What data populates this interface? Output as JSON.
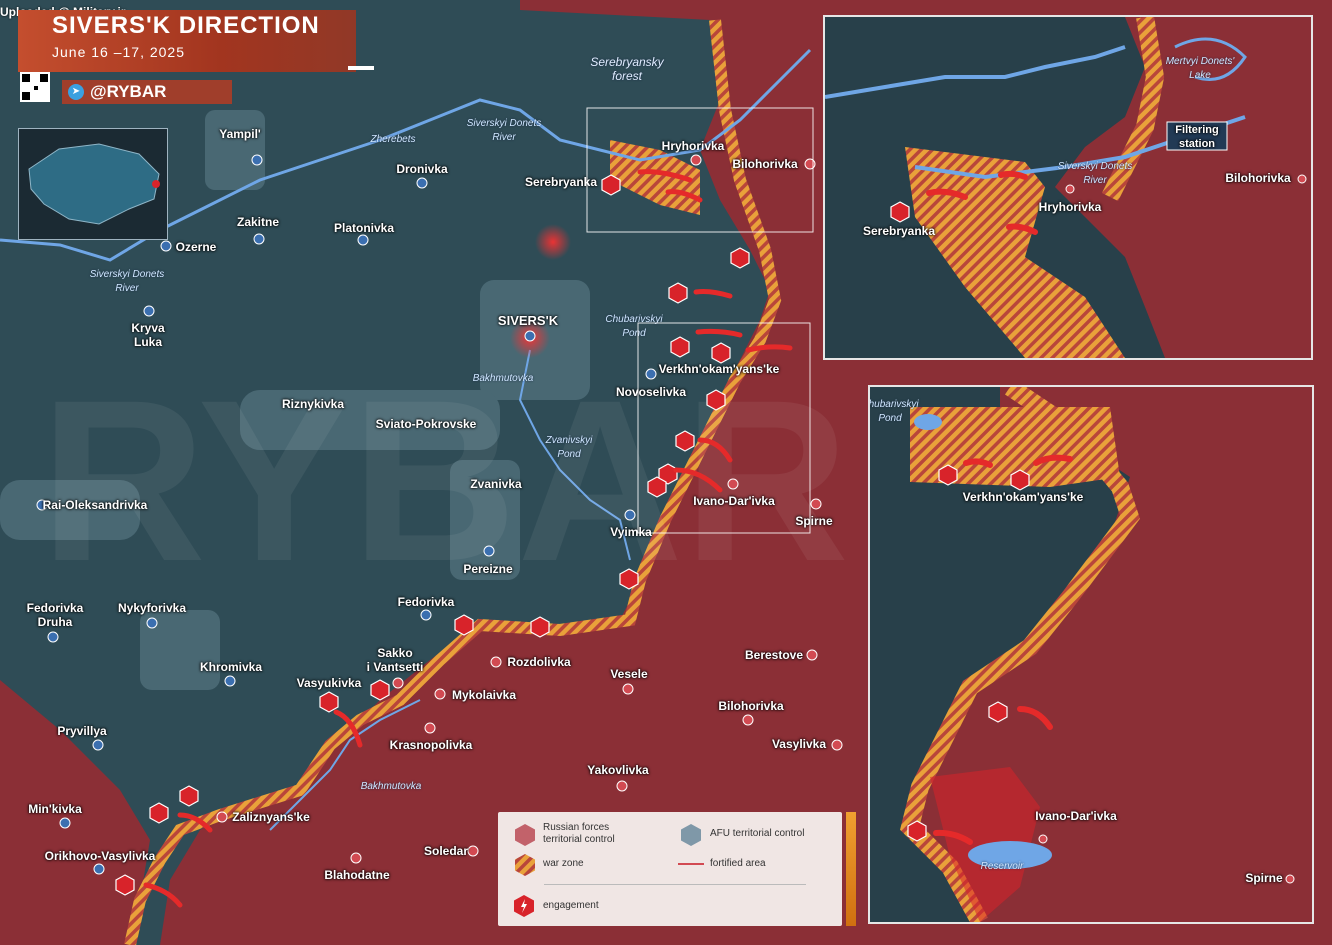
{
  "uploaded": "Uploaded @ Military.ir",
  "header": {
    "title": "SIVERS'K DIRECTION",
    "date": "June 16 –17, 2025"
  },
  "brand": {
    "handle": "@RYBAR"
  },
  "colors": {
    "russian": "#8b2f36",
    "afu": "#2f4c56",
    "warzone_a": "#e9a13a",
    "warzone_b": "#b9463a",
    "engagement": "#d8232a"
  },
  "places": {
    "yampil": "Yampil'",
    "dronivka": "Dronivka",
    "zakitne": "Zakitne",
    "platonivka": "Platonivka",
    "ozerne": "Ozerne",
    "kryva_luka": "Kryva\nLuka",
    "siversk": "SIVERS'K",
    "serebryanka": "Serebryanka",
    "hryhorivka": "Hryhorivka",
    "bilohorivka_n": "Bilohorivka",
    "verkhnokamyanske": "Verkhn'okam'yans'ke",
    "novoselivka": "Novoselivka",
    "riznykivka": "Riznykivka",
    "sviato_pokrovske": "Sviato-Pokrovske",
    "rai_oleksandrivka": "Rai-Oleksandrivka",
    "zvanivka": "Zvanivka",
    "vyimka": "Vyimka",
    "ivano_darivka": "Ivano-Dar'ivka",
    "spirne": "Spirne",
    "pereizne": "Pereizne",
    "fedorivka": "Fedorivka",
    "fedorivka_druha": "Fedorivka\nDruha",
    "nykyforivka": "Nykyforivka",
    "khromivka": "Khromivka",
    "sakko": "Sakko\ni Vantsetti",
    "vasyukivka": "Vasyukivka",
    "rozdolivka": "Rozdolivka",
    "mykolaivka": "Mykolaivka",
    "vesele": "Vesele",
    "berestove": "Berestove",
    "bilohorivka_s": "Bilohorivka",
    "vasylivka": "Vasylivka",
    "krasnopolivka": "Krasnopolivka",
    "pryvillya": "Pryvillya",
    "yakovlivka": "Yakovlivka",
    "minkivka": "Min'kivka",
    "zaliznyanske": "Zaliznyans'ke",
    "orikhovo_vasylivka": "Orikhovo-Vasylivka",
    "soledar": "Soledar",
    "blahodatne": "Blahodatne"
  },
  "water": {
    "serebryansky_forest": "Serebryansky\nforest",
    "zherebets": "Zherebets",
    "siverskyi_donets_1": "Siverskyi Donets\nRiver",
    "siverskyi_donets_2": "Siverskyi Donets\nRiver",
    "chubarivskyi_pond": "Chubarivskyi\nPond",
    "bakhmutovka_1": "Bakhmutovka",
    "zvanivskyi_pond": "Zvanivskyi\nPond",
    "bakhmutovka_2": "Bakhmutovka"
  },
  "inset_top": {
    "serebryanka": "Serebryanka",
    "hryhorivka": "Hryhorivka",
    "bilohorivka": "Bilohorivka",
    "river": "Siverskyi Donets\nRiver",
    "lake": "Mertvyi Donets'\nLake",
    "filtering": "Filtering\nstation"
  },
  "inset_right": {
    "pond": "Chubarivskyi\nPond",
    "verkhnokamyanske": "Verkhn'okam'yans'ke",
    "ivano_darivka": "Ivano-Dar'ivka",
    "reservoir": "Reservoir",
    "spirne": "Spirne"
  },
  "legend": {
    "russian": "Russian forces\nterritorial control",
    "afu": "AFU territorial control",
    "warzone": "war zone",
    "fortified": "fortified area",
    "engagement": "engagement"
  }
}
